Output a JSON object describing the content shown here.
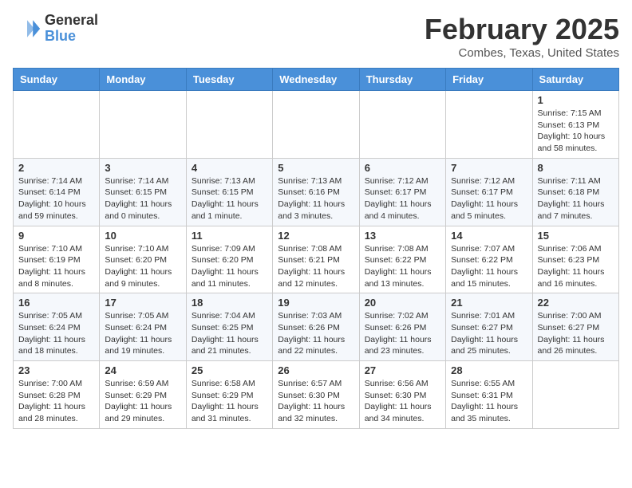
{
  "header": {
    "logo_general": "General",
    "logo_blue": "Blue",
    "month_title": "February 2025",
    "location": "Combes, Texas, United States"
  },
  "days_of_week": [
    "Sunday",
    "Monday",
    "Tuesday",
    "Wednesday",
    "Thursday",
    "Friday",
    "Saturday"
  ],
  "weeks": [
    [
      {
        "day": "",
        "info": ""
      },
      {
        "day": "",
        "info": ""
      },
      {
        "day": "",
        "info": ""
      },
      {
        "day": "",
        "info": ""
      },
      {
        "day": "",
        "info": ""
      },
      {
        "day": "",
        "info": ""
      },
      {
        "day": "1",
        "info": "Sunrise: 7:15 AM\nSunset: 6:13 PM\nDaylight: 10 hours\nand 58 minutes."
      }
    ],
    [
      {
        "day": "2",
        "info": "Sunrise: 7:14 AM\nSunset: 6:14 PM\nDaylight: 10 hours\nand 59 minutes."
      },
      {
        "day": "3",
        "info": "Sunrise: 7:14 AM\nSunset: 6:15 PM\nDaylight: 11 hours\nand 0 minutes."
      },
      {
        "day": "4",
        "info": "Sunrise: 7:13 AM\nSunset: 6:15 PM\nDaylight: 11 hours\nand 1 minute."
      },
      {
        "day": "5",
        "info": "Sunrise: 7:13 AM\nSunset: 6:16 PM\nDaylight: 11 hours\nand 3 minutes."
      },
      {
        "day": "6",
        "info": "Sunrise: 7:12 AM\nSunset: 6:17 PM\nDaylight: 11 hours\nand 4 minutes."
      },
      {
        "day": "7",
        "info": "Sunrise: 7:12 AM\nSunset: 6:17 PM\nDaylight: 11 hours\nand 5 minutes."
      },
      {
        "day": "8",
        "info": "Sunrise: 7:11 AM\nSunset: 6:18 PM\nDaylight: 11 hours\nand 7 minutes."
      }
    ],
    [
      {
        "day": "9",
        "info": "Sunrise: 7:10 AM\nSunset: 6:19 PM\nDaylight: 11 hours\nand 8 minutes."
      },
      {
        "day": "10",
        "info": "Sunrise: 7:10 AM\nSunset: 6:20 PM\nDaylight: 11 hours\nand 9 minutes."
      },
      {
        "day": "11",
        "info": "Sunrise: 7:09 AM\nSunset: 6:20 PM\nDaylight: 11 hours\nand 11 minutes."
      },
      {
        "day": "12",
        "info": "Sunrise: 7:08 AM\nSunset: 6:21 PM\nDaylight: 11 hours\nand 12 minutes."
      },
      {
        "day": "13",
        "info": "Sunrise: 7:08 AM\nSunset: 6:22 PM\nDaylight: 11 hours\nand 13 minutes."
      },
      {
        "day": "14",
        "info": "Sunrise: 7:07 AM\nSunset: 6:22 PM\nDaylight: 11 hours\nand 15 minutes."
      },
      {
        "day": "15",
        "info": "Sunrise: 7:06 AM\nSunset: 6:23 PM\nDaylight: 11 hours\nand 16 minutes."
      }
    ],
    [
      {
        "day": "16",
        "info": "Sunrise: 7:05 AM\nSunset: 6:24 PM\nDaylight: 11 hours\nand 18 minutes."
      },
      {
        "day": "17",
        "info": "Sunrise: 7:05 AM\nSunset: 6:24 PM\nDaylight: 11 hours\nand 19 minutes."
      },
      {
        "day": "18",
        "info": "Sunrise: 7:04 AM\nSunset: 6:25 PM\nDaylight: 11 hours\nand 21 minutes."
      },
      {
        "day": "19",
        "info": "Sunrise: 7:03 AM\nSunset: 6:26 PM\nDaylight: 11 hours\nand 22 minutes."
      },
      {
        "day": "20",
        "info": "Sunrise: 7:02 AM\nSunset: 6:26 PM\nDaylight: 11 hours\nand 23 minutes."
      },
      {
        "day": "21",
        "info": "Sunrise: 7:01 AM\nSunset: 6:27 PM\nDaylight: 11 hours\nand 25 minutes."
      },
      {
        "day": "22",
        "info": "Sunrise: 7:00 AM\nSunset: 6:27 PM\nDaylight: 11 hours\nand 26 minutes."
      }
    ],
    [
      {
        "day": "23",
        "info": "Sunrise: 7:00 AM\nSunset: 6:28 PM\nDaylight: 11 hours\nand 28 minutes."
      },
      {
        "day": "24",
        "info": "Sunrise: 6:59 AM\nSunset: 6:29 PM\nDaylight: 11 hours\nand 29 minutes."
      },
      {
        "day": "25",
        "info": "Sunrise: 6:58 AM\nSunset: 6:29 PM\nDaylight: 11 hours\nand 31 minutes."
      },
      {
        "day": "26",
        "info": "Sunrise: 6:57 AM\nSunset: 6:30 PM\nDaylight: 11 hours\nand 32 minutes."
      },
      {
        "day": "27",
        "info": "Sunrise: 6:56 AM\nSunset: 6:30 PM\nDaylight: 11 hours\nand 34 minutes."
      },
      {
        "day": "28",
        "info": "Sunrise: 6:55 AM\nSunset: 6:31 PM\nDaylight: 11 hours\nand 35 minutes."
      },
      {
        "day": "",
        "info": ""
      }
    ]
  ]
}
